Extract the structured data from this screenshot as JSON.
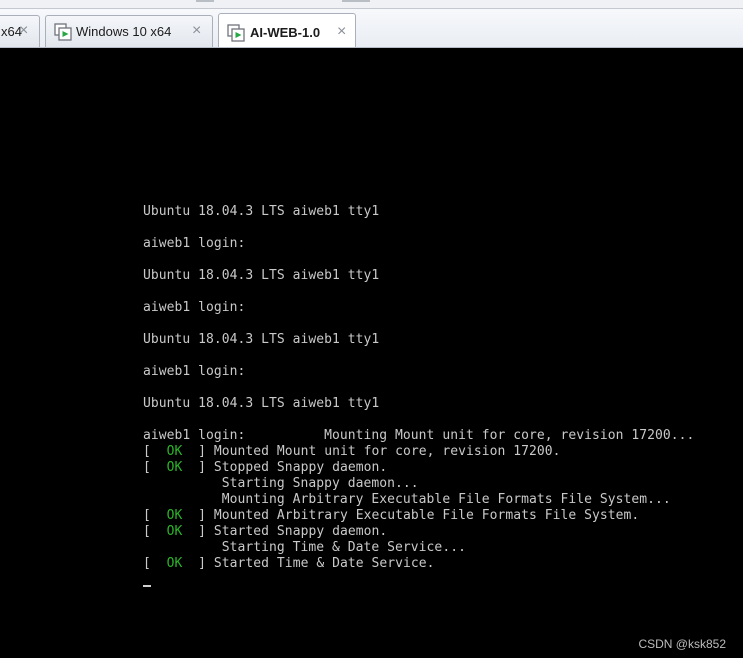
{
  "tabs": [
    {
      "label": "x64",
      "active": false,
      "close_glyph": "×",
      "icon": "vm-icon"
    },
    {
      "label": "Windows 10 x64",
      "active": false,
      "close_glyph": "×",
      "icon": "vm-icon"
    },
    {
      "label": "AI-WEB-1.0",
      "active": true,
      "close_glyph": "×",
      "icon": "vm-icon"
    }
  ],
  "console": {
    "lines": [
      {
        "text": "Ubuntu 18.04.3 LTS aiweb1 tty1"
      },
      {
        "text": ""
      },
      {
        "text": "aiweb1 login:"
      },
      {
        "text": ""
      },
      {
        "text": "Ubuntu 18.04.3 LTS aiweb1 tty1"
      },
      {
        "text": ""
      },
      {
        "text": "aiweb1 login:"
      },
      {
        "text": ""
      },
      {
        "text": "Ubuntu 18.04.3 LTS aiweb1 tty1"
      },
      {
        "text": ""
      },
      {
        "text": "aiweb1 login:"
      },
      {
        "text": ""
      },
      {
        "text": "Ubuntu 18.04.3 LTS aiweb1 tty1"
      },
      {
        "text": ""
      },
      {
        "text": "aiweb1 login:          Mounting Mount unit for core, revision 17200..."
      },
      {
        "status": "OK",
        "text": "Mounted Mount unit for core, revision 17200."
      },
      {
        "status": "OK",
        "text": "Stopped Snappy daemon."
      },
      {
        "text": "          Starting Snappy daemon..."
      },
      {
        "text": "          Mounting Arbitrary Executable File Formats File System..."
      },
      {
        "status": "OK",
        "text": "Mounted Arbitrary Executable File Formats File System."
      },
      {
        "status": "OK",
        "text": "Started Snappy daemon."
      },
      {
        "text": "          Starting Time & Date Service..."
      },
      {
        "status": "OK",
        "text": "Started Time & Date Service."
      }
    ]
  },
  "watermark": "CSDN @ksk852",
  "colors": {
    "terminal_bg": "#000000",
    "terminal_text": "#c9c9c9",
    "ok_green": "#2ab52a"
  }
}
